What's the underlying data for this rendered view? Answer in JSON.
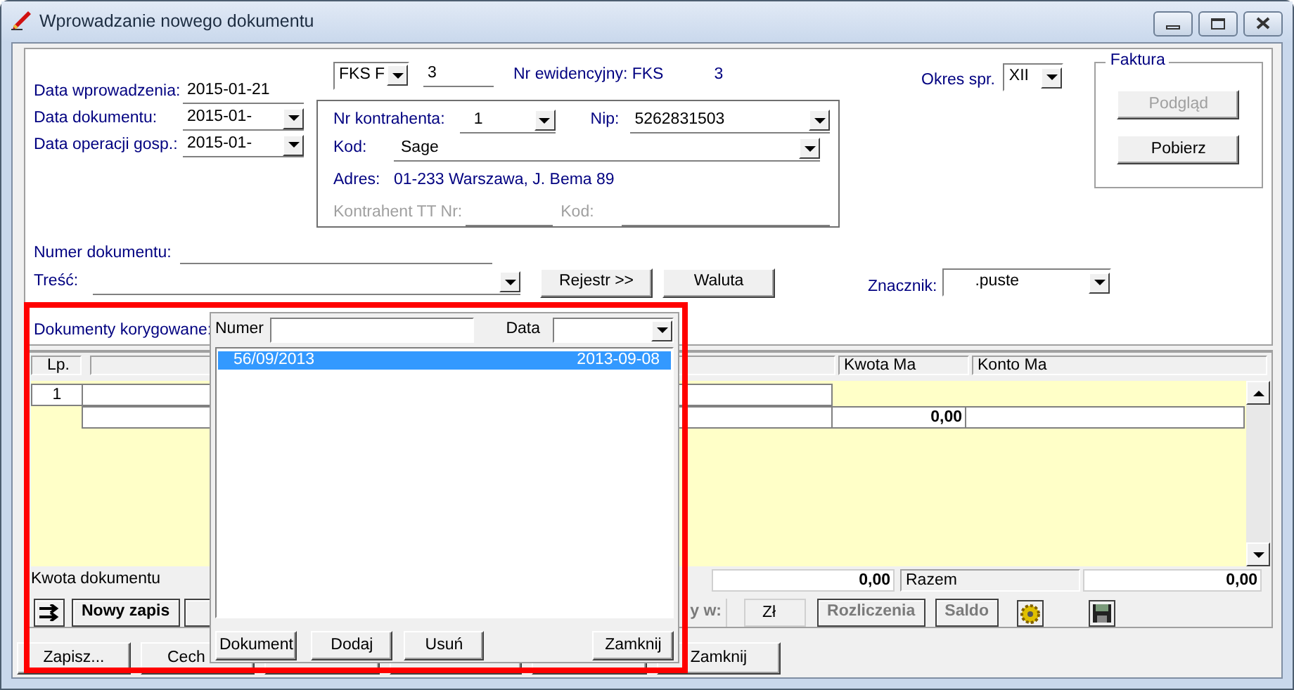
{
  "window": {
    "title": "Wprowadzanie nowego dokumentu"
  },
  "dates": [
    {
      "label": "Data wprowadzenia:",
      "value": "2015-01-21",
      "kind": "text"
    },
    {
      "label": "Data dokumentu:",
      "value": "2015-01-",
      "kind": "dropdown"
    },
    {
      "label": "Data operacji gosp.:",
      "value": "2015-01-",
      "kind": "dropdown"
    }
  ],
  "register": {
    "type": "FKS  F",
    "number": "3",
    "evidence_label": "Nr ewidencyjny: FKS",
    "evidence_number": "3"
  },
  "contractor": {
    "number_label": "Nr kontrahenta:",
    "number": "1",
    "nip_label": "Nip:",
    "nip": "5262831503",
    "code_label": "Kod:",
    "code": "Sage",
    "address_label": "Adres:",
    "address": "01-233 Warszawa, J. Bema 89",
    "tt_label": "Kontrahent TT Nr:",
    "tt_code_label": "Kod:",
    "tt_disabled": true
  },
  "period": {
    "label": "Okres spr.",
    "value": "XII"
  },
  "invoice": {
    "title": "Faktura",
    "buttons": [
      {
        "label": "Podgląd",
        "disabled": true
      },
      {
        "label": "Pobierz",
        "disabled": false
      }
    ]
  },
  "document_number": {
    "label": "Numer dokumentu:"
  },
  "content": {
    "label": "Treść:"
  },
  "register_buttons": [
    "Rejestr >>",
    "Waluta"
  ],
  "marker": {
    "label": "Znacznik:",
    "value": ".puste"
  },
  "corrected_label": "Dokumenty korygowane:",
  "grid": {
    "columns": [
      "Lp.",
      "Kwota Ma",
      "Konto Ma"
    ],
    "rows": [
      {
        "lp": "1"
      },
      {
        "kwota_ma": "0,00"
      }
    ]
  },
  "totals": {
    "label": "Kwota dokumentu",
    "amount": "0,00",
    "sum_label": "Razem",
    "sum": "0,00"
  },
  "toolbar": [
    {
      "kind": "swap"
    },
    {
      "kind": "button",
      "label": "Nowy zapis",
      "disabled": false
    },
    {
      "kind": "covered"
    },
    {
      "kind": "label",
      "label": "y w:"
    },
    {
      "kind": "box",
      "label": "Zł"
    },
    {
      "kind": "button",
      "label": "Rozliczenia",
      "disabled": true
    },
    {
      "kind": "button",
      "label": "Saldo",
      "disabled": true
    },
    {
      "kind": "gear"
    },
    {
      "kind": "save"
    }
  ],
  "bottom_buttons": [
    {
      "kind": "button",
      "label": "Zapisz..."
    },
    {
      "kind": "button",
      "label": "Cech"
    },
    {
      "kind": "covered"
    },
    {
      "kind": "covered"
    },
    {
      "kind": "covered"
    },
    {
      "kind": "button",
      "label": "Zamknij"
    }
  ],
  "popup": {
    "number_label": "Numer",
    "date_label": "Data",
    "rows": [
      {
        "number": "56/09/2013",
        "date": "2013-09-08",
        "selected": true
      }
    ],
    "buttons": [
      "Dokument",
      "Dodaj",
      "Usuń",
      "Zamknij"
    ]
  }
}
